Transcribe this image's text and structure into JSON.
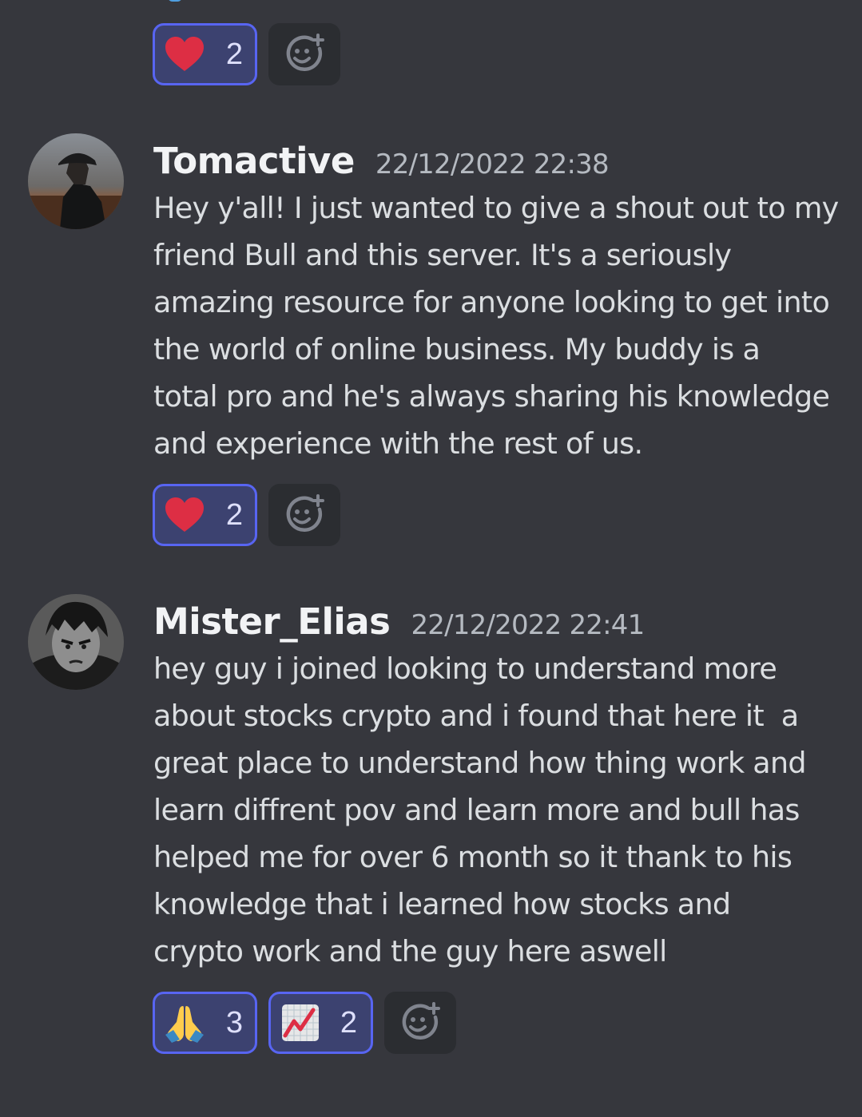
{
  "colors": {
    "background": "#36373d",
    "reaction_active_bg": "#3c4270",
    "reaction_active_border": "#5865f2",
    "add_reaction_bg": "#2b2d31"
  },
  "top_reactions": [
    {
      "icon": "heart-icon",
      "count": "2"
    }
  ],
  "messages": [
    {
      "username": "Tomactive",
      "timestamp": "22/12/2022 22:38",
      "lines": [
        "Hey y'all! I just wanted to give a shout out to my",
        "friend Bull and this server. It's a seriously",
        "amazing resource for anyone looking to get into",
        "the world of online business. My buddy is a",
        "total pro and he's always sharing his knowledge",
        "and experience with the rest of us."
      ],
      "reactions": [
        {
          "icon": "heart-icon",
          "count": "2"
        }
      ]
    },
    {
      "username": "Mister_Elias",
      "timestamp": "22/12/2022 22:41",
      "lines": [
        "hey guy i joined looking to understand more",
        "about stocks crypto and i found that here it  a",
        "great place to understand how thing work and",
        "learn diffrent pov and learn more and bull has",
        "helped me for over 6 month so it thank to his",
        "knowledge that i learned how stocks and",
        "crypto work and the guy here aswell"
      ],
      "reactions": [
        {
          "icon": "folded-hands-icon",
          "count": "3"
        },
        {
          "icon": "chart-increasing-icon",
          "count": "2"
        }
      ]
    }
  ]
}
